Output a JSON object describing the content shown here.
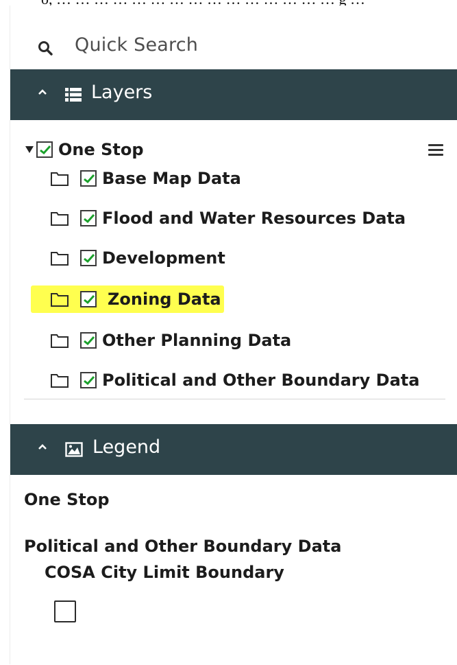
{
  "top_text": "o, … … … … … … … … … … … … … … … g …",
  "search": {
    "label": "Quick Search",
    "icon": "search-icon"
  },
  "layers": {
    "header": "Layers",
    "root": {
      "label": "One Stop",
      "checked": true
    },
    "items": [
      {
        "label": "Base Map Data",
        "checked": true,
        "highlighted": false
      },
      {
        "label": "Flood and Water Resources Data",
        "checked": true,
        "highlighted": false
      },
      {
        "label": "Development",
        "checked": true,
        "highlighted": false
      },
      {
        "label": "Zoning Data",
        "checked": true,
        "highlighted": true
      },
      {
        "label": "Other Planning Data",
        "checked": true,
        "highlighted": false
      },
      {
        "label": "Political and Other Boundary Data",
        "checked": true,
        "highlighted": false
      }
    ]
  },
  "legend": {
    "header": "Legend",
    "group": "One Stop",
    "layer": "Political and Other Boundary Data",
    "sublayer": "COSA City Limit Boundary"
  },
  "colors": {
    "header_bg": "#2e444a",
    "check_green": "#1aa12b",
    "highlight": "#ffff4f"
  }
}
